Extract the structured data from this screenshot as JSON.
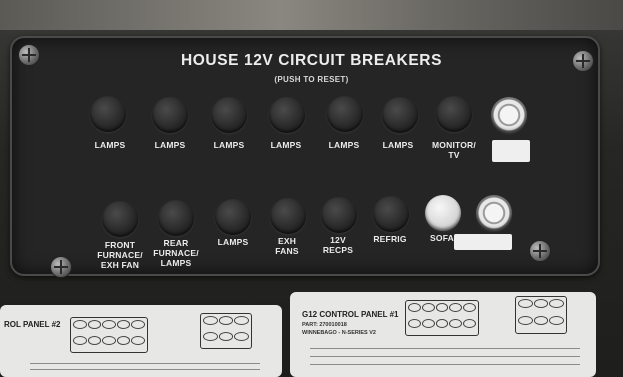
{
  "panel": {
    "title": "HOUSE 12V CIRCUIT BREAKERS",
    "subtitle": "(PUSH TO RESET)"
  },
  "top_row": [
    {
      "label": "LAMPS"
    },
    {
      "label": "LAMPS"
    },
    {
      "label": "LAMPS"
    },
    {
      "label": "LAMPS"
    },
    {
      "label": "LAMPS"
    },
    {
      "label": "LAMPS"
    },
    {
      "label": "MONITOR/\nTV"
    }
  ],
  "bottom_row": [
    {
      "label": "FRONT\nFURNACE/\nEXH FAN"
    },
    {
      "label": "REAR\nFURNACE/\nLAMPS"
    },
    {
      "label": "LAMPS"
    },
    {
      "label": "EXH\nFANS"
    },
    {
      "label": "12V\nRECPS"
    },
    {
      "label": "REFRIG"
    },
    {
      "label": "SOFA"
    }
  ],
  "cards": {
    "left_title": "ROL PANEL #2",
    "right_title": "G12 CONTROL PANEL #1",
    "right_part": "PART: 270010018",
    "right_model": "WINNEBAGO - N-SERIES V2"
  }
}
